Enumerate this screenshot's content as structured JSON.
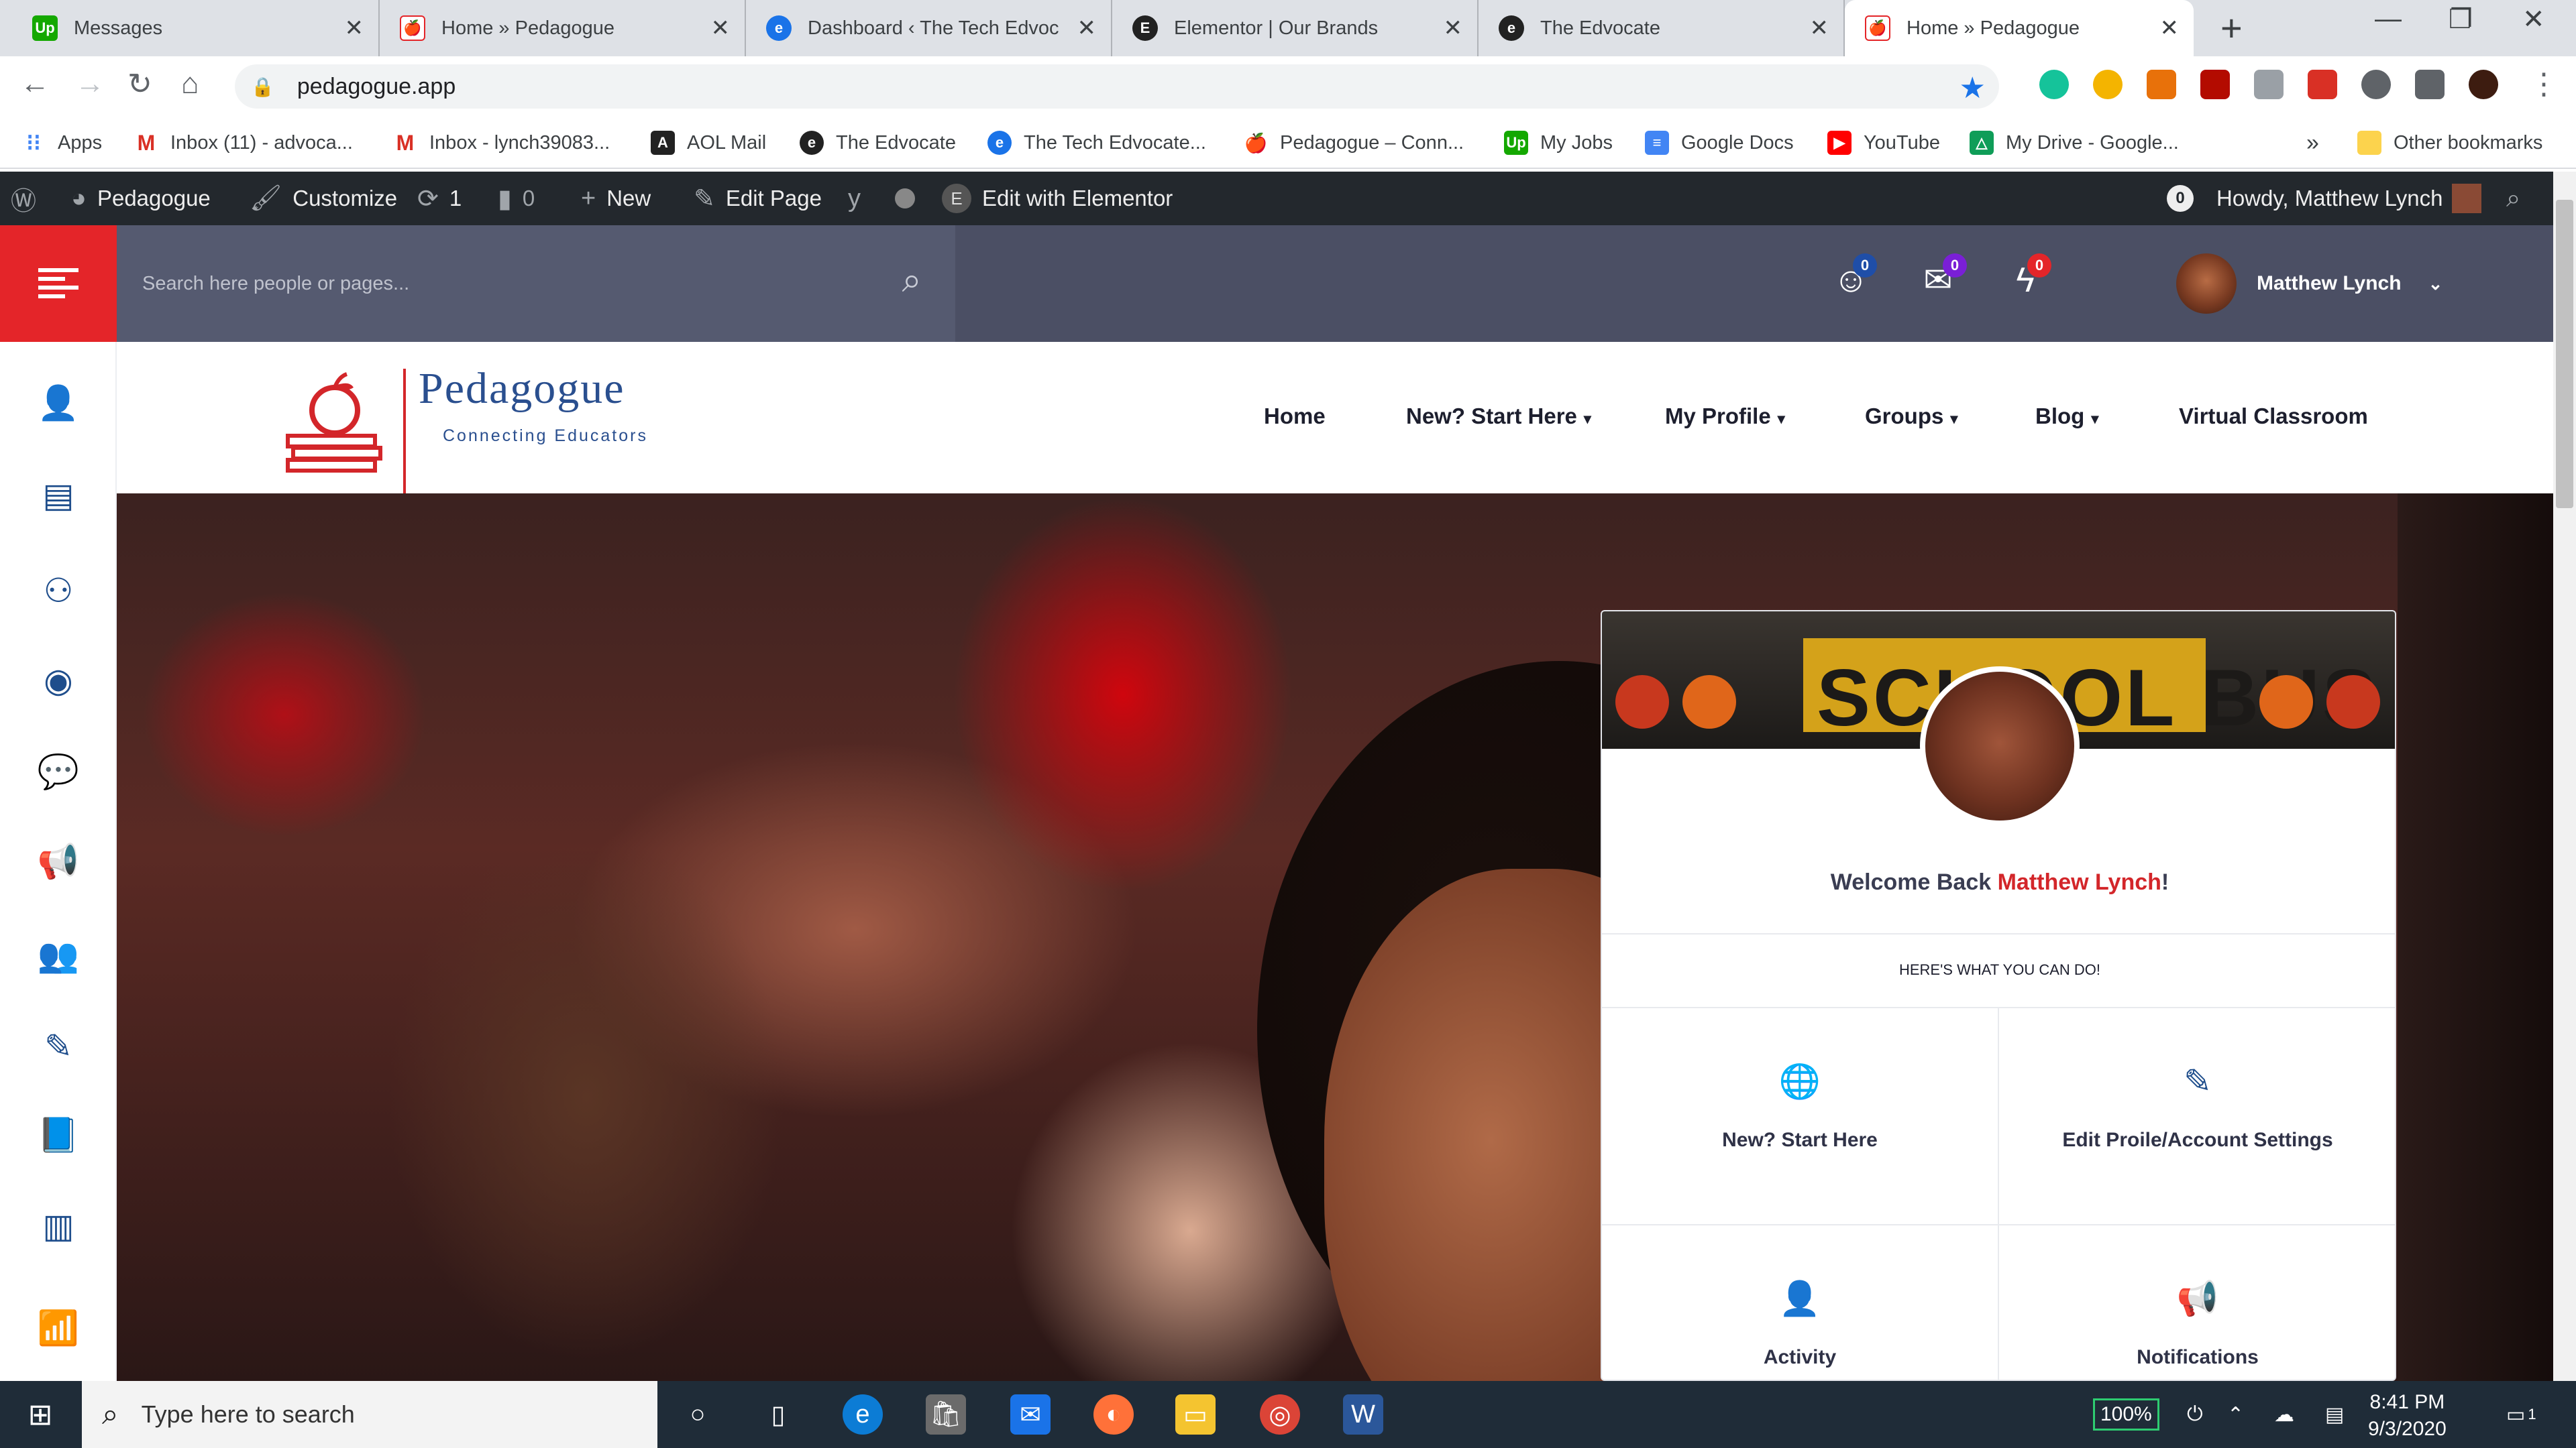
{
  "browser": {
    "tabs": [
      {
        "title": "Messages",
        "favicon": "upwork-icon",
        "color": "#14a800"
      },
      {
        "title": "Home » Pedagogue",
        "favicon": "pedagogue-icon",
        "color": "#e42529"
      },
      {
        "title": "Dashboard ‹ The Tech Edvoc",
        "favicon": "edvocate-icon",
        "color": "#1a73e8"
      },
      {
        "title": "Elementor | Our Brands",
        "favicon": "elementor-icon",
        "color": "#222"
      },
      {
        "title": "The Edvocate",
        "favicon": "edvocate-icon",
        "color": "#222"
      },
      {
        "title": "Home » Pedagogue",
        "favicon": "pedagogue-icon",
        "color": "#e42529",
        "active": true
      }
    ],
    "url": "pedagogue.app",
    "bookmarks": [
      {
        "label": "Apps",
        "icon": "apps-grid-icon",
        "color": "#4285f4"
      },
      {
        "label": "Inbox (11) - advoca...",
        "icon": "gmail-icon",
        "color": "#d93025"
      },
      {
        "label": "Inbox - lynch39083...",
        "icon": "gmail-icon",
        "color": "#d93025"
      },
      {
        "label": "AOL Mail",
        "icon": "aol-icon",
        "color": "#222"
      },
      {
        "label": "The Edvocate",
        "icon": "edvocate-icon",
        "color": "#222"
      },
      {
        "label": "The Tech Edvocate...",
        "icon": "edvocate-icon",
        "color": "#1a73e8"
      },
      {
        "label": "Pedagogue – Conn...",
        "icon": "pedagogue-icon",
        "color": "#e42529"
      },
      {
        "label": "My Jobs",
        "icon": "upwork-icon",
        "color": "#14a800"
      },
      {
        "label": "Google Docs",
        "icon": "docs-icon",
        "color": "#4285f4"
      },
      {
        "label": "YouTube",
        "icon": "youtube-icon",
        "color": "#ff0000"
      },
      {
        "label": "My Drive - Google...",
        "icon": "drive-icon",
        "color": "#0f9d58"
      }
    ],
    "bookmarks_overflow": "»",
    "other_bookmarks": "Other bookmarks"
  },
  "wp_admin_bar": {
    "site": "Pedagogue",
    "customize": "Customize",
    "updates_count": "1",
    "comments_count": "0",
    "new": "New",
    "edit_page": "Edit Page",
    "edit_elementor": "Edit with Elementor",
    "notif_count": "0",
    "howdy": "Howdy, Matthew Lynch"
  },
  "site_header": {
    "search_placeholder": "Search here people or pages...",
    "friend_requests_badge": "0",
    "messages_badge": "0",
    "notifications_badge": "0",
    "user_name": "Matthew Lynch",
    "colors": {
      "accent": "#e42529",
      "dark": "#4b4f64",
      "icon_blue": "#1f4e8c"
    }
  },
  "site_nav": {
    "brand": "Pedagogue",
    "tagline": "Connecting Educators",
    "menu": [
      {
        "label": "Home"
      },
      {
        "label": "New? Start Here",
        "dropdown": true
      },
      {
        "label": "My Profile",
        "dropdown": true
      },
      {
        "label": "Groups",
        "dropdown": true
      },
      {
        "label": "Blog",
        "dropdown": true
      },
      {
        "label": "Virtual Classroom"
      }
    ]
  },
  "welcome_card": {
    "cover_text": "SCHOOL BUS",
    "welcome_prefix": "Welcome Back ",
    "welcome_name": "Matthew Lynch",
    "welcome_suffix": "!",
    "subtitle": "HERE'S WHAT YOU CAN DO!",
    "actions": [
      {
        "label": "New? Start Here",
        "icon": "globe-icon"
      },
      {
        "label": "Edit Proile/Account Settings",
        "icon": "pencil-icon"
      },
      {
        "label": "Activity",
        "icon": "user-icon"
      },
      {
        "label": "Notifications",
        "icon": "megaphone-icon"
      }
    ]
  },
  "taskbar": {
    "search_placeholder": "Type here to search",
    "battery": "100%",
    "time": "8:41 PM",
    "date": "9/3/2020",
    "notif_count": "1"
  }
}
